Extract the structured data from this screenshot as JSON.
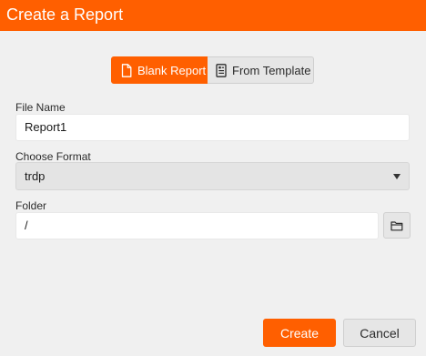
{
  "dialog": {
    "title": "Create a Report"
  },
  "source_toggle": {
    "options": [
      {
        "label": "Blank Report",
        "icon": "blank-page-icon",
        "selected": true
      },
      {
        "label": "From Template",
        "icon": "template-document-icon",
        "selected": false
      }
    ]
  },
  "form": {
    "file_name": {
      "label": "File Name",
      "value": "Report1"
    },
    "format": {
      "label": "Choose Format",
      "value": "trdp"
    },
    "folder": {
      "label": "Folder",
      "value": "/",
      "browse_icon": "folder-icon"
    }
  },
  "footer": {
    "create_label": "Create",
    "cancel_label": "Cancel"
  },
  "colors": {
    "accent": "#ff5f00",
    "background": "#f0f0f0"
  }
}
